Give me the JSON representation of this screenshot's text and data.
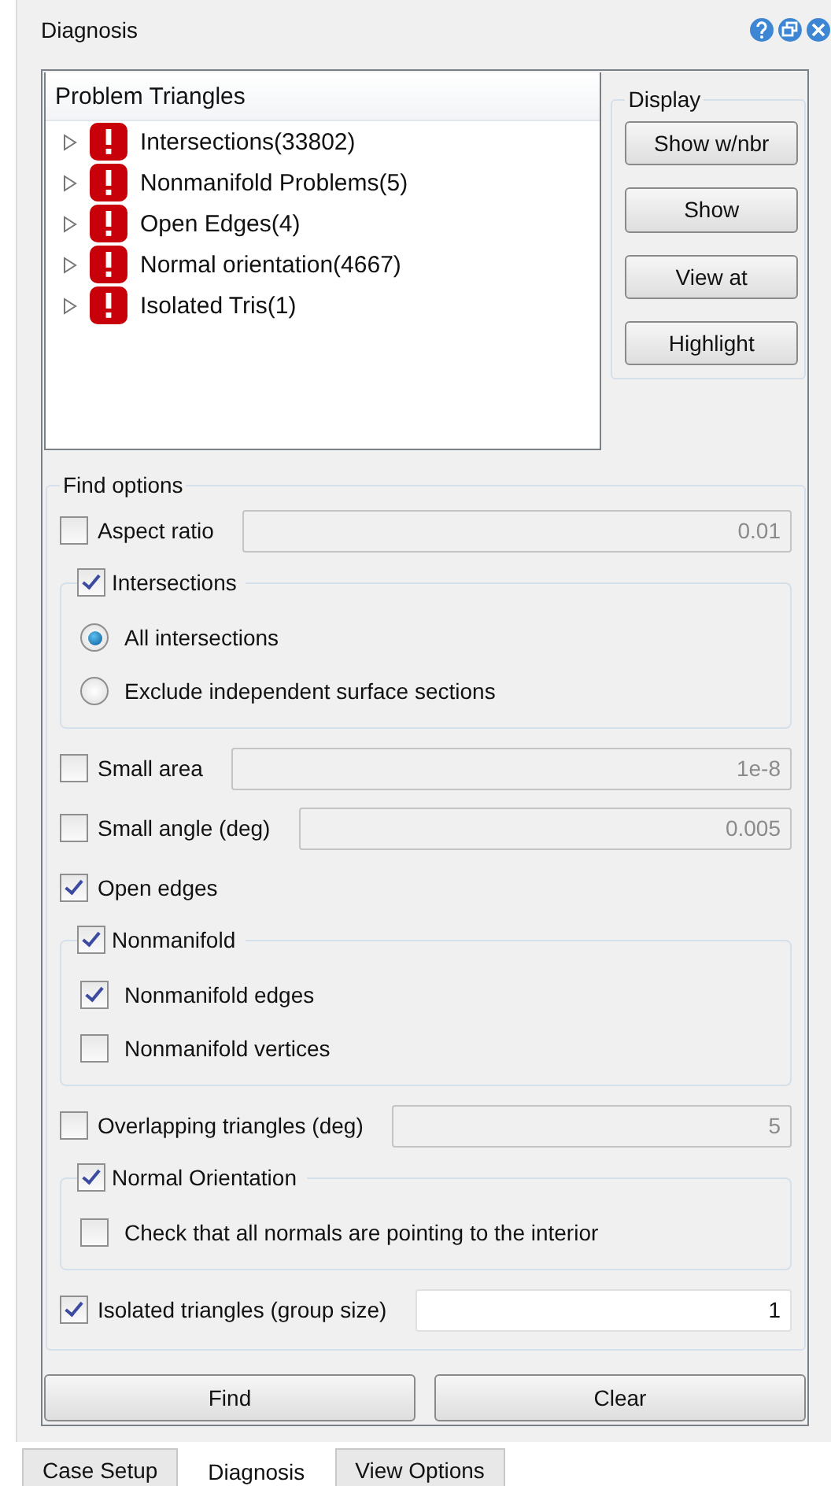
{
  "window": {
    "title": "Diagnosis"
  },
  "problem_tree": {
    "header": "Problem Triangles",
    "items": [
      {
        "label": "Intersections(33802)",
        "expanded": false
      },
      {
        "label": "Nonmanifold Problems(5)",
        "expanded": false
      },
      {
        "label": "Open Edges(4)",
        "expanded": false
      },
      {
        "label": "Normal orientation(4667)",
        "expanded": false
      },
      {
        "label": "Isolated Tris(1)",
        "expanded": false
      }
    ]
  },
  "display": {
    "title": "Display",
    "buttons": [
      "Show w/nbr",
      "Show",
      "View at",
      "Highlight"
    ]
  },
  "find_options": {
    "title": "Find options",
    "items": [
      {
        "kind": "field",
        "label": "Aspect ratio",
        "checked": false,
        "value": "0.01"
      },
      {
        "kind": "group",
        "label": "Intersections",
        "checked": true,
        "children": [
          {
            "kind": "radio",
            "label": "All intersections",
            "selected": true
          },
          {
            "kind": "radio",
            "label": "Exclude independent surface sections",
            "selected": false
          }
        ]
      },
      {
        "kind": "field",
        "label": "Small area",
        "checked": false,
        "value": "1e-8"
      },
      {
        "kind": "field",
        "label": "Small angle (deg)",
        "checked": false,
        "value": "0.005"
      },
      {
        "kind": "check",
        "label": "Open edges",
        "checked": true
      },
      {
        "kind": "group",
        "label": "Nonmanifold",
        "checked": true,
        "children": [
          {
            "kind": "check",
            "label": "Nonmanifold edges",
            "checked": true
          },
          {
            "kind": "check",
            "label": "Nonmanifold vertices",
            "checked": false
          }
        ]
      },
      {
        "kind": "field",
        "label": "Overlapping triangles (deg)",
        "checked": false,
        "value": "5"
      },
      {
        "kind": "group",
        "label": "Normal Orientation",
        "checked": true,
        "children": [
          {
            "kind": "check",
            "label": "Check that all normals are pointing to the interior",
            "checked": false
          }
        ]
      },
      {
        "kind": "field",
        "label": "Isolated triangles (group size)",
        "checked": true,
        "value": "1"
      }
    ]
  },
  "actions": [
    "Find",
    "Clear"
  ],
  "tabs": [
    {
      "label": "Case Setup",
      "selected": false
    },
    {
      "label": "Diagnosis",
      "selected": true
    },
    {
      "label": "View Options",
      "selected": false
    }
  ]
}
